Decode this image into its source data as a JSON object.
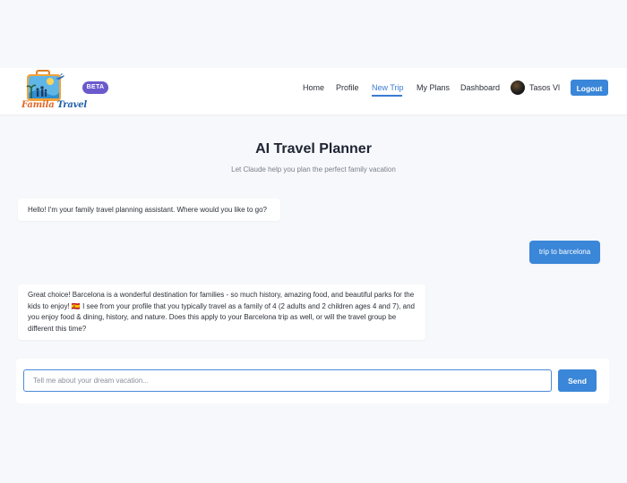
{
  "brand": {
    "logo_word1": "Famila",
    "logo_word2": "Travel",
    "badge": "BETA"
  },
  "nav": {
    "items": [
      {
        "label": "Home",
        "active": false
      },
      {
        "label": "Profile",
        "active": false
      },
      {
        "label": "New Trip",
        "active": true
      },
      {
        "label": "My Plans",
        "active": false
      },
      {
        "label": "Dashboard",
        "active": false
      }
    ],
    "user_name": "Tasos Vl",
    "logout_label": "Logout"
  },
  "page": {
    "title": "AI Travel Planner",
    "subtitle": "Let Claude help you plan the perfect family vacation"
  },
  "chat": {
    "messages": [
      {
        "role": "assistant",
        "text": "Hello! I'm your family travel planning assistant. Where would you like to go?"
      },
      {
        "role": "user",
        "text": "trip to barcelona"
      },
      {
        "role": "assistant",
        "text": "Great choice! Barcelona is a wonderful destination for families - so much history, amazing food, and beautiful parks for the kids to enjoy! 🇪🇸 I see from your profile that you typically travel as a family of 4 (2 adults and 2 children ages 4 and 7), and you enjoy food & dining, history, and nature. Does this apply to your Barcelona trip as well, or will the travel group be different this time?"
      }
    ],
    "input_placeholder": "Tell me about your dream vacation...",
    "input_value": "",
    "send_label": "Send"
  },
  "colors": {
    "accent": "#3a86d8",
    "badge": "#6a5acd",
    "background": "#f7f8fb"
  }
}
